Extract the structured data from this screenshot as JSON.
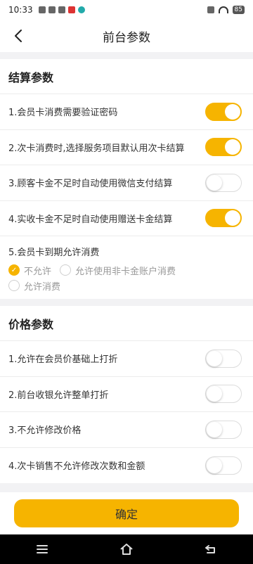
{
  "status_bar": {
    "time": "10:33",
    "battery": "85"
  },
  "header": {
    "title": "前台参数"
  },
  "sections": {
    "settlement": {
      "title": "结算参数",
      "items": [
        {
          "label": "1.会员卡消费需要验证密码",
          "on": true
        },
        {
          "label": "2.次卡消费时,选择服务项目默认用次卡结算",
          "on": true
        },
        {
          "label": "3.顾客卡金不足时自动使用微信支付结算",
          "on": false
        },
        {
          "label": "4.实收卡金不足时自动使用赠送卡金结算",
          "on": true
        }
      ],
      "expiry": {
        "title": "5.会员卡到期允许消费",
        "options": [
          "不允许",
          "允许使用非卡金账户消费",
          "允许消费"
        ],
        "selected": "不允许"
      }
    },
    "price": {
      "title": "价格参数",
      "items": [
        {
          "label": "1.允许在会员价基础上打折",
          "on": false
        },
        {
          "label": "2.前台收银允许整单打折",
          "on": false
        },
        {
          "label": "3.不允许修改价格",
          "on": false
        },
        {
          "label": "4.次卡销售不允许修改次数和金额",
          "on": false
        }
      ]
    }
  },
  "footer": {
    "confirm_label": "确定"
  },
  "colors": {
    "accent": "#f6b400",
    "background": "#f2f2f4"
  }
}
